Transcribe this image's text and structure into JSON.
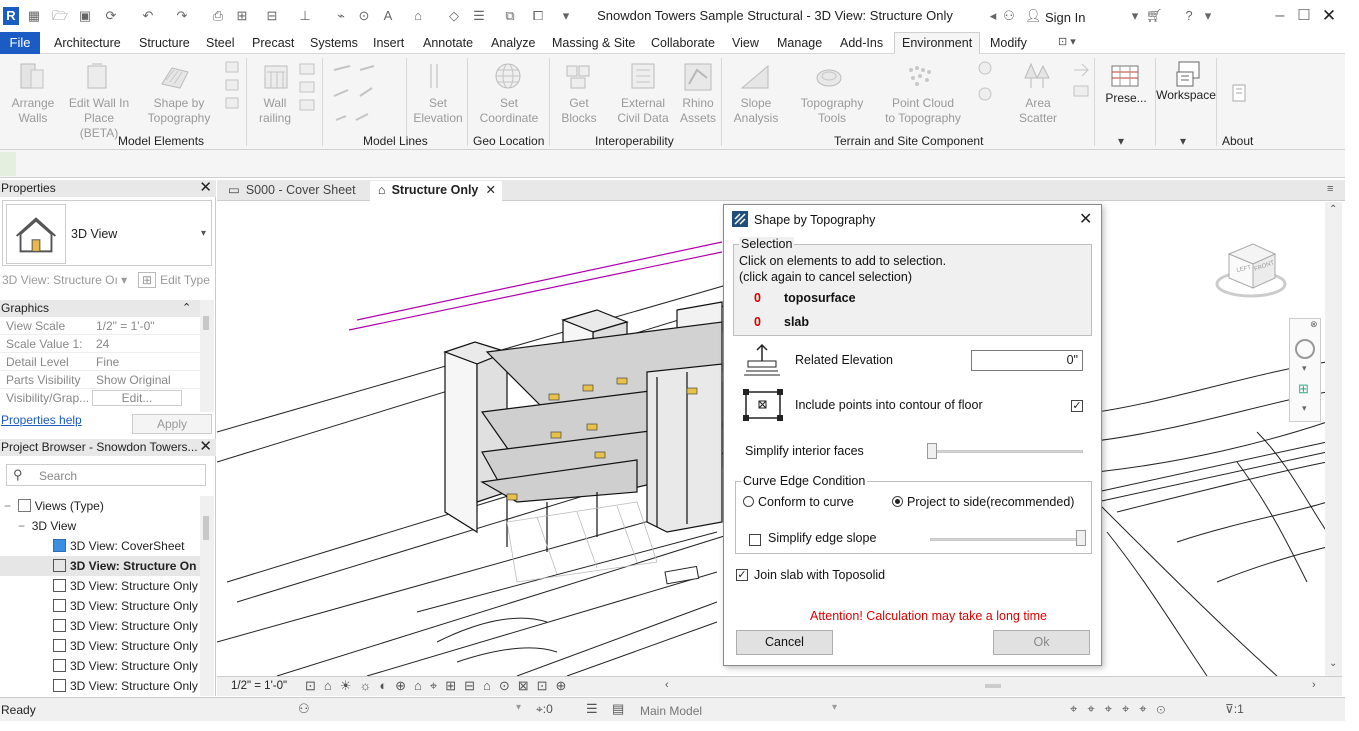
{
  "window": {
    "title": "Snowdon Towers Sample Structural - 3D View: Structure Only",
    "sign_in": "Sign In"
  },
  "menu": [
    "File",
    "Architecture",
    "Structure",
    "Steel",
    "Precast",
    "Systems",
    "Insert",
    "Annotate",
    "Analyze",
    "Massing & Site",
    "Collaborate",
    "View",
    "Manage",
    "Add-Ins",
    "Environment",
    "Modify"
  ],
  "active_menu": "Environment",
  "ribbon": {
    "tools": [
      {
        "label": "Arrange\nWalls",
        "icon": "arrange-walls-icon"
      },
      {
        "label": "Edit Wall In\nPlace (BETA)",
        "icon": "edit-wall-icon"
      },
      {
        "label": "Shape by\nTopography",
        "icon": "shape-by-topography-icon"
      },
      {
        "label": "Wall\nrailing",
        "icon": "wall-railing-icon"
      },
      {
        "label": "Set\nElevation",
        "icon": "set-elevation-icon"
      },
      {
        "label": "Set\nCoordinate",
        "icon": "globe-icon"
      },
      {
        "label": "Get\nBlocks",
        "icon": "get-blocks-icon"
      },
      {
        "label": "External\nCivil Data",
        "icon": "civil-data-icon"
      },
      {
        "label": "Rhino\nAssets",
        "icon": "rhino-icon"
      },
      {
        "label": "Slope\nAnalysis",
        "icon": "slope-icon"
      },
      {
        "label": "Topography\nTools",
        "icon": "topography-icon"
      },
      {
        "label": "Point Cloud\nto Topography",
        "icon": "point-cloud-icon"
      },
      {
        "label": "Area\nScatter",
        "icon": "tree-icon"
      },
      {
        "label": "Prese...",
        "icon": "presets-icon"
      },
      {
        "label": "Workspace",
        "icon": "workspace-icon"
      }
    ],
    "panels": [
      "Model Elements",
      "Model Lines",
      "Geo Location",
      "Interoperability",
      "Terrain and Site Component",
      "About"
    ]
  },
  "properties": {
    "title": "Properties",
    "type_name": "3D View",
    "instance_selector": "3D View: Structure Oı",
    "edit_type": "Edit Type",
    "section": "Graphics",
    "rows": [
      {
        "key": "View Scale",
        "value": "1/2\" = 1'-0\""
      },
      {
        "key": "Scale Value    1:",
        "value": "24"
      },
      {
        "key": "Detail Level",
        "value": "Fine"
      },
      {
        "key": "Parts Visibility",
        "value": "Show Original"
      },
      {
        "key": "Visibility/Grap...",
        "value": "Edit..."
      }
    ],
    "help_link": "Properties help",
    "apply": "Apply"
  },
  "browser": {
    "title": "Project Browser - Snowdon Towers...",
    "search_placeholder": "Search",
    "root": "Views (Type)",
    "group": "3D View",
    "items": [
      "3D View: CoverSheet",
      "3D View: Structure On",
      "3D View: Structure Only",
      "3D View: Structure Only",
      "3D View: Structure Only",
      "3D View: Structure Only",
      "3D View: Structure Only",
      "3D View: Structure Only"
    ]
  },
  "tabs": [
    {
      "label": "S000 - Cover Sheet",
      "active": false
    },
    {
      "label": "Structure Only",
      "active": true
    }
  ],
  "viewbar": {
    "scale": "1/2\" = 1'-0\""
  },
  "status": {
    "text": "Ready",
    "coord": ":0",
    "model": "Main Model",
    "filter": ":1"
  },
  "dialog": {
    "title": "Shape by Topography",
    "selection_label": "Selection",
    "selection_help_1": "Click on elements to add to selection.",
    "selection_help_2": "(click again to cancel selection)",
    "toposurface_count": "0",
    "toposurface_label": "toposurface",
    "slab_count": "0",
    "slab_label": "slab",
    "related_elevation_label": "Related Elevation",
    "related_elevation_value": "0\"",
    "include_points_label": "Include points into contour of floor",
    "include_points_checked": true,
    "simplify_faces_label": "Simplify interior faces",
    "curve_edge_label": "Curve Edge Condition",
    "conform_label": "Conform to curve",
    "project_label": "Project to side(recommended)",
    "simplify_slope_label": "Simplify edge slope",
    "join_label": "Join slab with Toposolid",
    "join_checked": true,
    "warning": "Attention! Calculation may take a long time",
    "cancel": "Cancel",
    "ok": "Ok"
  },
  "viewcube": {
    "left": "LEFT",
    "front": "FRONT"
  }
}
